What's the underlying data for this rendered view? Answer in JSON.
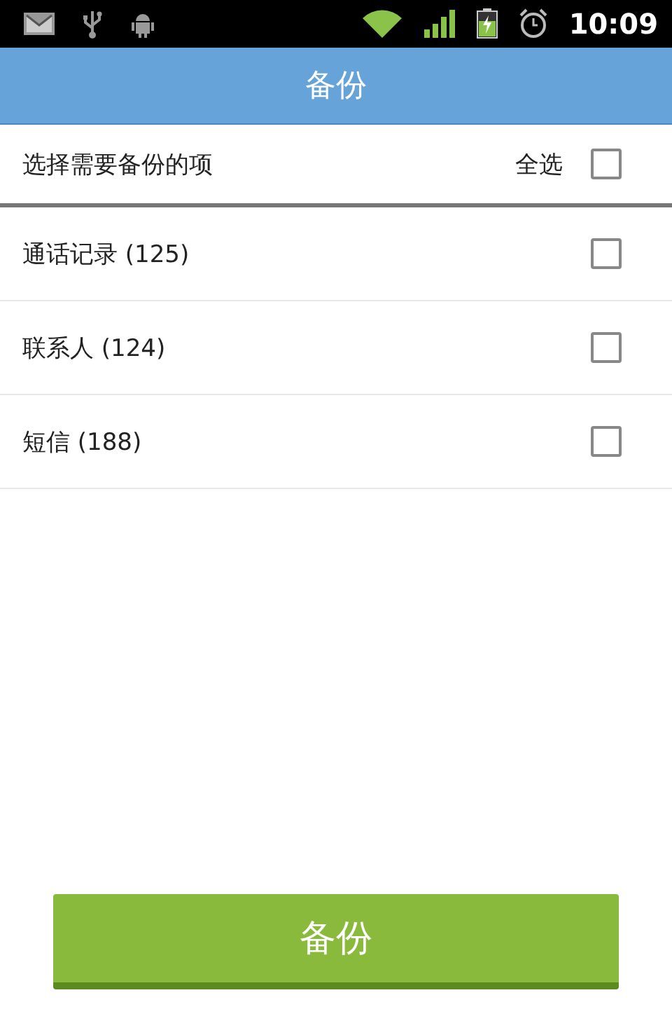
{
  "status_bar": {
    "time": "10:09"
  },
  "title": "备份",
  "select_all": {
    "prompt": "选择需要备份的项",
    "label": "全选",
    "checked": false
  },
  "items": [
    {
      "label": "通话记录 (125)",
      "checked": false
    },
    {
      "label": "联系人 (124)",
      "checked": false
    },
    {
      "label": "短信 (188)",
      "checked": false
    }
  ],
  "button": "备份"
}
